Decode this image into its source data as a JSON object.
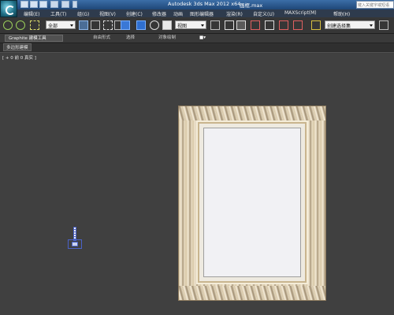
{
  "title_bar": {
    "app_title": "Autodesk 3ds Max  2012 x64",
    "file_name": "画框.max",
    "search_placeholder": "键入关键字或短语",
    "quick_access_icons": [
      "new-icon",
      "open-icon",
      "save-icon",
      "undo-icon",
      "redo-icon",
      "dropdown-icon"
    ]
  },
  "menu": {
    "items": [
      "编辑(E)",
      "工具(T)",
      "组(G)",
      "视图(V)",
      "创建(C)",
      "修改器",
      "动画",
      "图形编辑器",
      "渲染(R)",
      "自定义(U)",
      "MAXScript(M)",
      "帮助(H)"
    ]
  },
  "toolbar": {
    "selection_filter": "全部",
    "reference_coord": "视图",
    "named_selection": "创建选择集"
  },
  "ribbon": {
    "tabs": [
      "Graphite 建模工具",
      "自由形式",
      "选择",
      "对象绘制"
    ],
    "sub_tab": "多边形建模"
  },
  "viewport": {
    "label": "[ + 0 前 0 真实 ]"
  },
  "colors": {
    "frame_gold": "#d8c8a8",
    "canvas": "#f1f1f4",
    "gizmo": "#4a62c8",
    "viewport_bg": "#404040"
  }
}
